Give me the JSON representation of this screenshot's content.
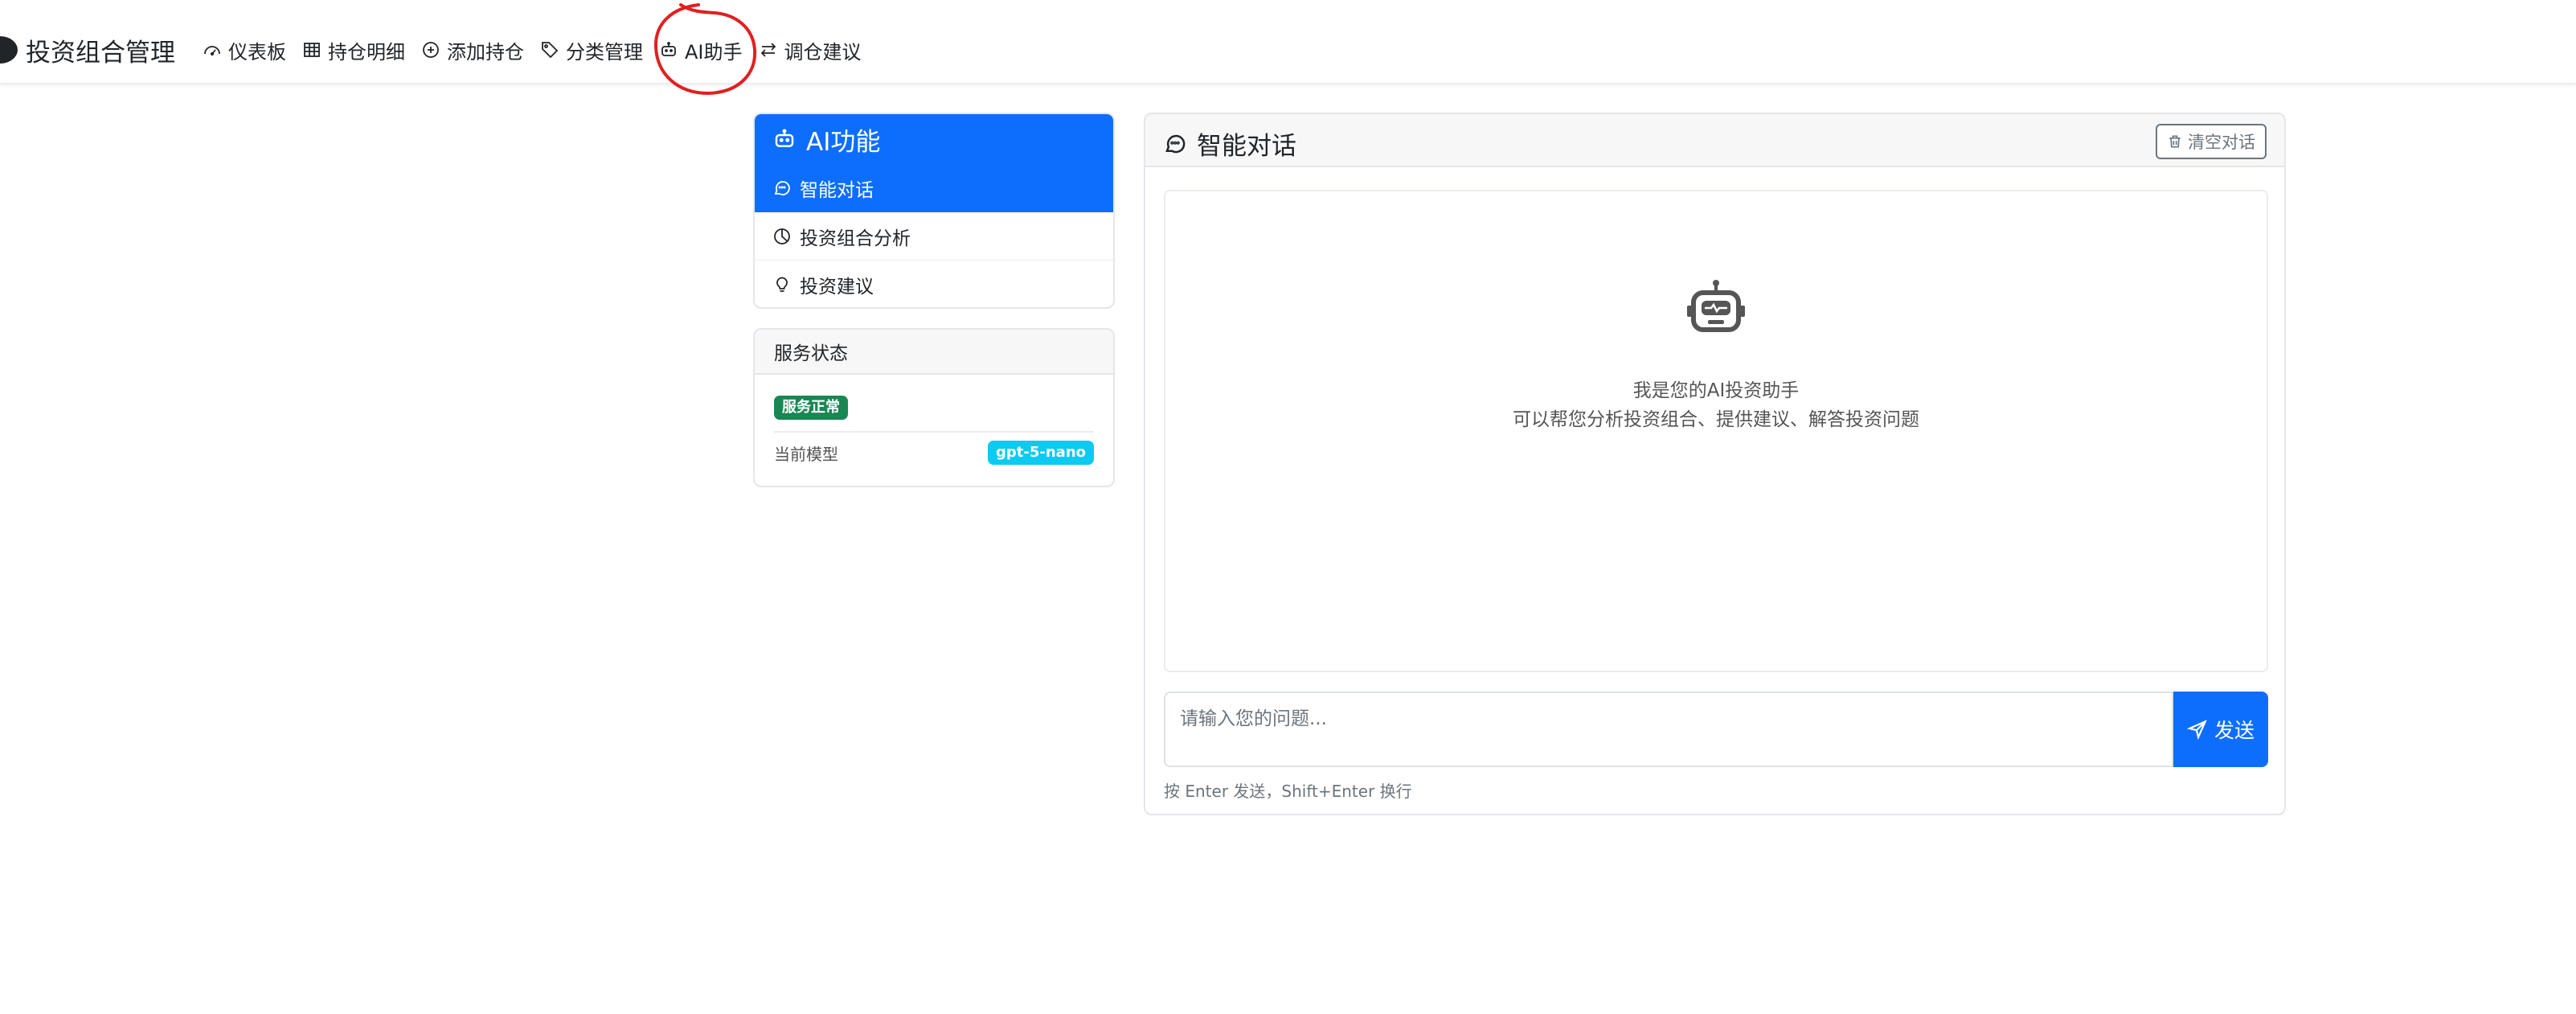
{
  "navbar": {
    "brand": "投资组合管理",
    "items": [
      {
        "label": "仪表板",
        "icon": "speedometer-icon"
      },
      {
        "label": "持仓明细",
        "icon": "table-icon"
      },
      {
        "label": "添加持仓",
        "icon": "plus-circle-icon"
      },
      {
        "label": "分类管理",
        "icon": "tag-icon"
      },
      {
        "label": "AI助手",
        "icon": "robot-icon",
        "active": true
      },
      {
        "label": "调仓建议",
        "icon": "arrow-left-right-icon"
      }
    ]
  },
  "sidebar": {
    "ai_title": "AI功能",
    "menu": [
      {
        "label": "智能对话",
        "icon": "chat-icon",
        "active": true
      },
      {
        "label": "投资组合分析",
        "icon": "pie-chart-icon"
      },
      {
        "label": "投资建议",
        "icon": "lightbulb-icon"
      }
    ],
    "status": {
      "title": "服务状态",
      "service_badge": "服务正常",
      "model_label": "当前模型",
      "model_value": "gpt-5-nano"
    }
  },
  "chat": {
    "title": "智能对话",
    "clear_label": "清空对话",
    "welcome_line1": "我是您的AI投资助手",
    "welcome_line2": "可以帮您分析投资组合、提供建议、解答投资问题",
    "input_placeholder": "请输入您的问题...",
    "send_label": "发送",
    "hint": "按 Enter 发送，Shift+Enter 换行"
  },
  "colors": {
    "primary": "#0d6efd",
    "success": "#198754",
    "info": "#0dcaf0",
    "annotation": "#e02020"
  }
}
